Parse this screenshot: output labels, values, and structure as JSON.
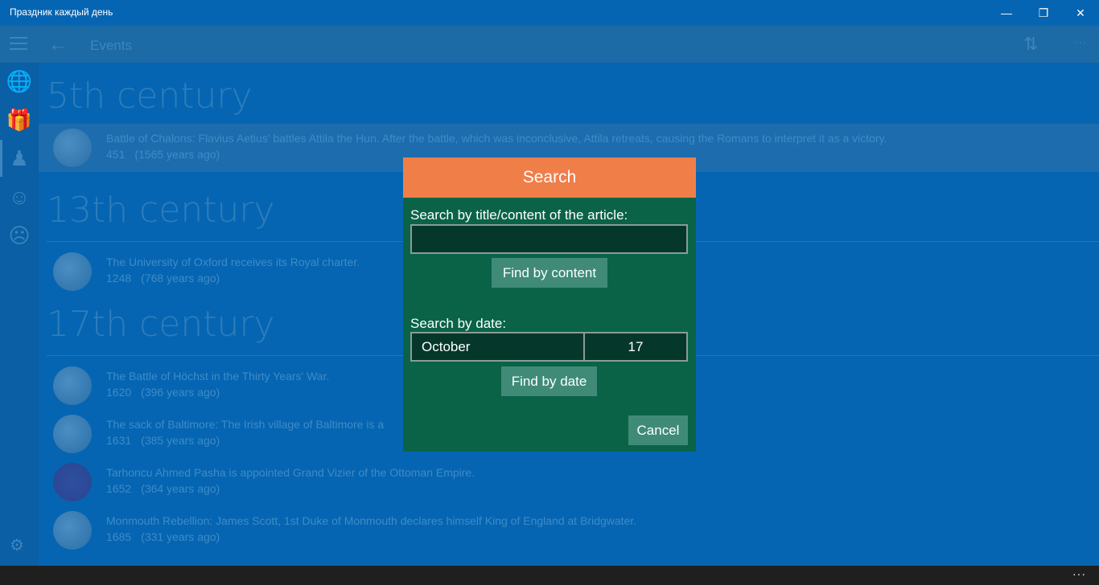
{
  "window": {
    "title": "Праздник каждый день",
    "minimize_glyph": "—",
    "maximize_glyph": "❐",
    "close_glyph": "✕"
  },
  "navbar": {
    "back_glyph": "←",
    "title": "Events",
    "sort_glyph": "⇅",
    "more_glyph": "···"
  },
  "sidebar": {
    "icons": [
      "globe-icon",
      "gift-icon",
      "chess-pawn-icon",
      "smile-icon",
      "frown-icon"
    ],
    "glyphs": [
      "🌐",
      "🎁",
      "♟",
      "☺",
      "☹"
    ],
    "settings_glyph": "⚙"
  },
  "sections": [
    {
      "century": "5th century",
      "events": [
        {
          "text": "Battle of Chalons: Flavius Aetius' battles Attila the Hun. After the battle, which was inconclusive, Attila retreats, causing the Romans to interpret it as a victory.",
          "year": "451",
          "ago": "(1565 years ago)"
        }
      ]
    },
    {
      "century": "13th century",
      "events": [
        {
          "text": "The University of Oxford receives its Royal charter.",
          "year": "1248",
          "ago": "(768 years ago)"
        }
      ]
    },
    {
      "century": "17th century",
      "events": [
        {
          "text": "The Battle of Höchst in the Thirty Years' War.",
          "year": "1620",
          "ago": "(396 years ago)"
        },
        {
          "text": "The sack of Baltimore: The Irish village of Baltimore is a",
          "year": "1631",
          "ago": "(385 years ago)"
        },
        {
          "text": "Tarhoncu Ahmed Pasha is appointed Grand Vizier of the Ottoman Empire.",
          "year": "1652",
          "ago": "(364 years ago)"
        },
        {
          "text": "Monmouth Rebellion: James Scott, 1st Duke of Monmouth declares himself King of England at Bridgwater.",
          "year": "1685",
          "ago": "(331 years ago)"
        }
      ]
    }
  ],
  "dialog": {
    "title": "Search",
    "content_label": "Search by title/content of the article:",
    "content_value": "",
    "find_content_label": "Find by content",
    "date_label": "Search by date:",
    "month": "October",
    "day": "17",
    "find_date_label": "Find by date",
    "cancel_label": "Cancel"
  },
  "bottombar": {
    "dots": "···"
  },
  "colors": {
    "accent": "#0565b2",
    "dialog_header": "#f07e49",
    "dialog_bg": "#0a6347"
  }
}
